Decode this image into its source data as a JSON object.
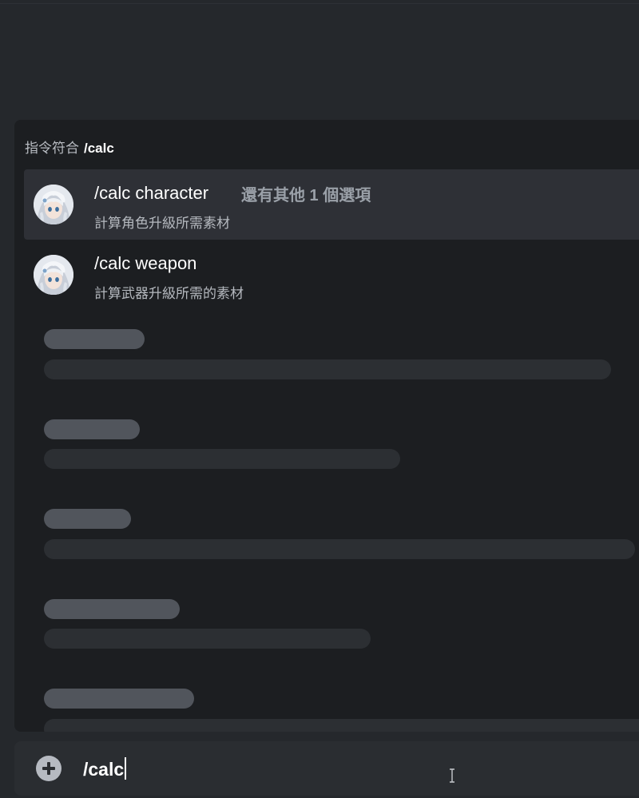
{
  "popup": {
    "header_label": "指令符合",
    "header_query": "/calc",
    "items": [
      {
        "name": "/calc character",
        "more": "還有其他 1 個選項",
        "description": "計算角色升級所需素材",
        "selected": true
      },
      {
        "name": "/calc weapon",
        "more": "",
        "description": "計算武器升級所需的素材",
        "selected": false
      }
    ],
    "skeleton_rows": 5
  },
  "input": {
    "value": "/calc",
    "plus_icon": "plus-circle-icon"
  },
  "colors": {
    "background": "#25282c",
    "popup_bg": "#1c1e21",
    "selected_bg": "#2e3036",
    "input_bg": "#2a2d31",
    "skeleton_title": "#51555c",
    "skeleton_line": "#2c2f33"
  }
}
